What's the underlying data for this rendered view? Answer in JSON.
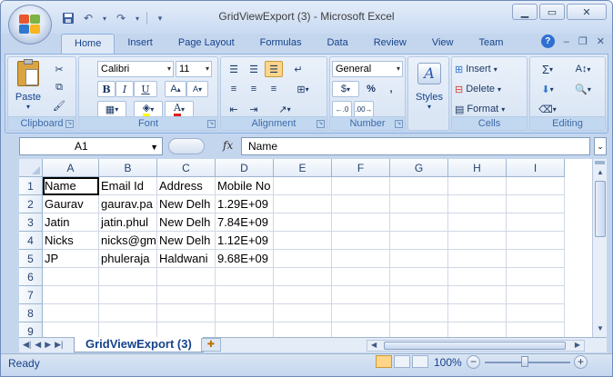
{
  "window": {
    "title": "GridViewExport (3) - Microsoft Excel"
  },
  "ribbon_tabs": [
    "Home",
    "Insert",
    "Page Layout",
    "Formulas",
    "Data",
    "Review",
    "View",
    "Team"
  ],
  "ribbon": {
    "clipboard": {
      "label": "Clipboard",
      "paste": "Paste"
    },
    "font": {
      "label": "Font",
      "name": "Calibri",
      "size": "11",
      "bold": "B",
      "italic": "I",
      "underline": "U"
    },
    "alignment": {
      "label": "Alignment"
    },
    "number": {
      "label": "Number",
      "format": "General",
      "percent": "%",
      "comma": ","
    },
    "styles": {
      "label": "Styles"
    },
    "cells": {
      "label": "Cells",
      "insert": "Insert",
      "delete": "Delete",
      "format": "Format"
    },
    "editing": {
      "label": "Editing"
    }
  },
  "formula_bar": {
    "name_box": "A1",
    "fx": "fx",
    "value": "Name"
  },
  "grid": {
    "columns": [
      "A",
      "B",
      "C",
      "D",
      "E",
      "F",
      "G",
      "H",
      "I"
    ],
    "rows": [
      "1",
      "2",
      "3",
      "4",
      "5",
      "6",
      "7",
      "8",
      "9"
    ],
    "cells": [
      [
        "Name",
        "Email Id",
        "Address",
        "Mobile No"
      ],
      [
        "Gaurav",
        "gaurav.pa",
        "New Delh",
        "1.29E+09"
      ],
      [
        "Jatin",
        "jatin.phul",
        "New Delh",
        "7.84E+09"
      ],
      [
        "Nicks",
        "nicks@gm",
        "New Delh",
        "1.12E+09"
      ],
      [
        "JP",
        "phuleraja",
        "Haldwani",
        "9.68E+09"
      ]
    ]
  },
  "sheet_tab": "GridViewExport (3)",
  "status": {
    "text": "Ready",
    "zoom": "100%"
  }
}
